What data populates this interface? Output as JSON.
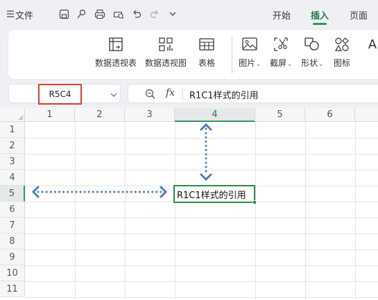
{
  "menubar": {
    "file_label": "文件",
    "tabs": [
      {
        "label": "开始",
        "active": false
      },
      {
        "label": "插入",
        "active": true
      },
      {
        "label": "页面",
        "active": false
      }
    ]
  },
  "ribbon": {
    "buttons": [
      {
        "label": "数据透视表",
        "icon": "pivot-table-icon"
      },
      {
        "label": "数据透视图",
        "icon": "pivot-chart-icon"
      },
      {
        "label": "表格",
        "icon": "table-icon"
      },
      {
        "label": "图片",
        "icon": "picture-icon",
        "dropdown": true
      },
      {
        "label": "截屏",
        "icon": "screenshot-icon",
        "dropdown": true
      },
      {
        "label": "形状",
        "icon": "shapes-icon",
        "dropdown": true
      },
      {
        "label": "图标",
        "icon": "icons-icon"
      },
      {
        "label": "A",
        "icon": "text-icon"
      }
    ]
  },
  "namebox": {
    "value": "R5C4"
  },
  "formula_bar": {
    "fx": "fx",
    "content": "R1C1样式的引用"
  },
  "grid": {
    "columns": [
      "1",
      "2",
      "3",
      "4",
      "5",
      "6"
    ],
    "rows": [
      "1",
      "2",
      "3",
      "4",
      "5",
      "6",
      "7",
      "8",
      "9",
      "10",
      "11"
    ],
    "selected_column": "4",
    "selected_row": "5",
    "active_cell_text": "R1C1样式的引用"
  },
  "colors": {
    "accent_green": "#2a9a5c",
    "highlight_red": "#e23b2e",
    "arrow_blue": "#4a7fbf"
  }
}
